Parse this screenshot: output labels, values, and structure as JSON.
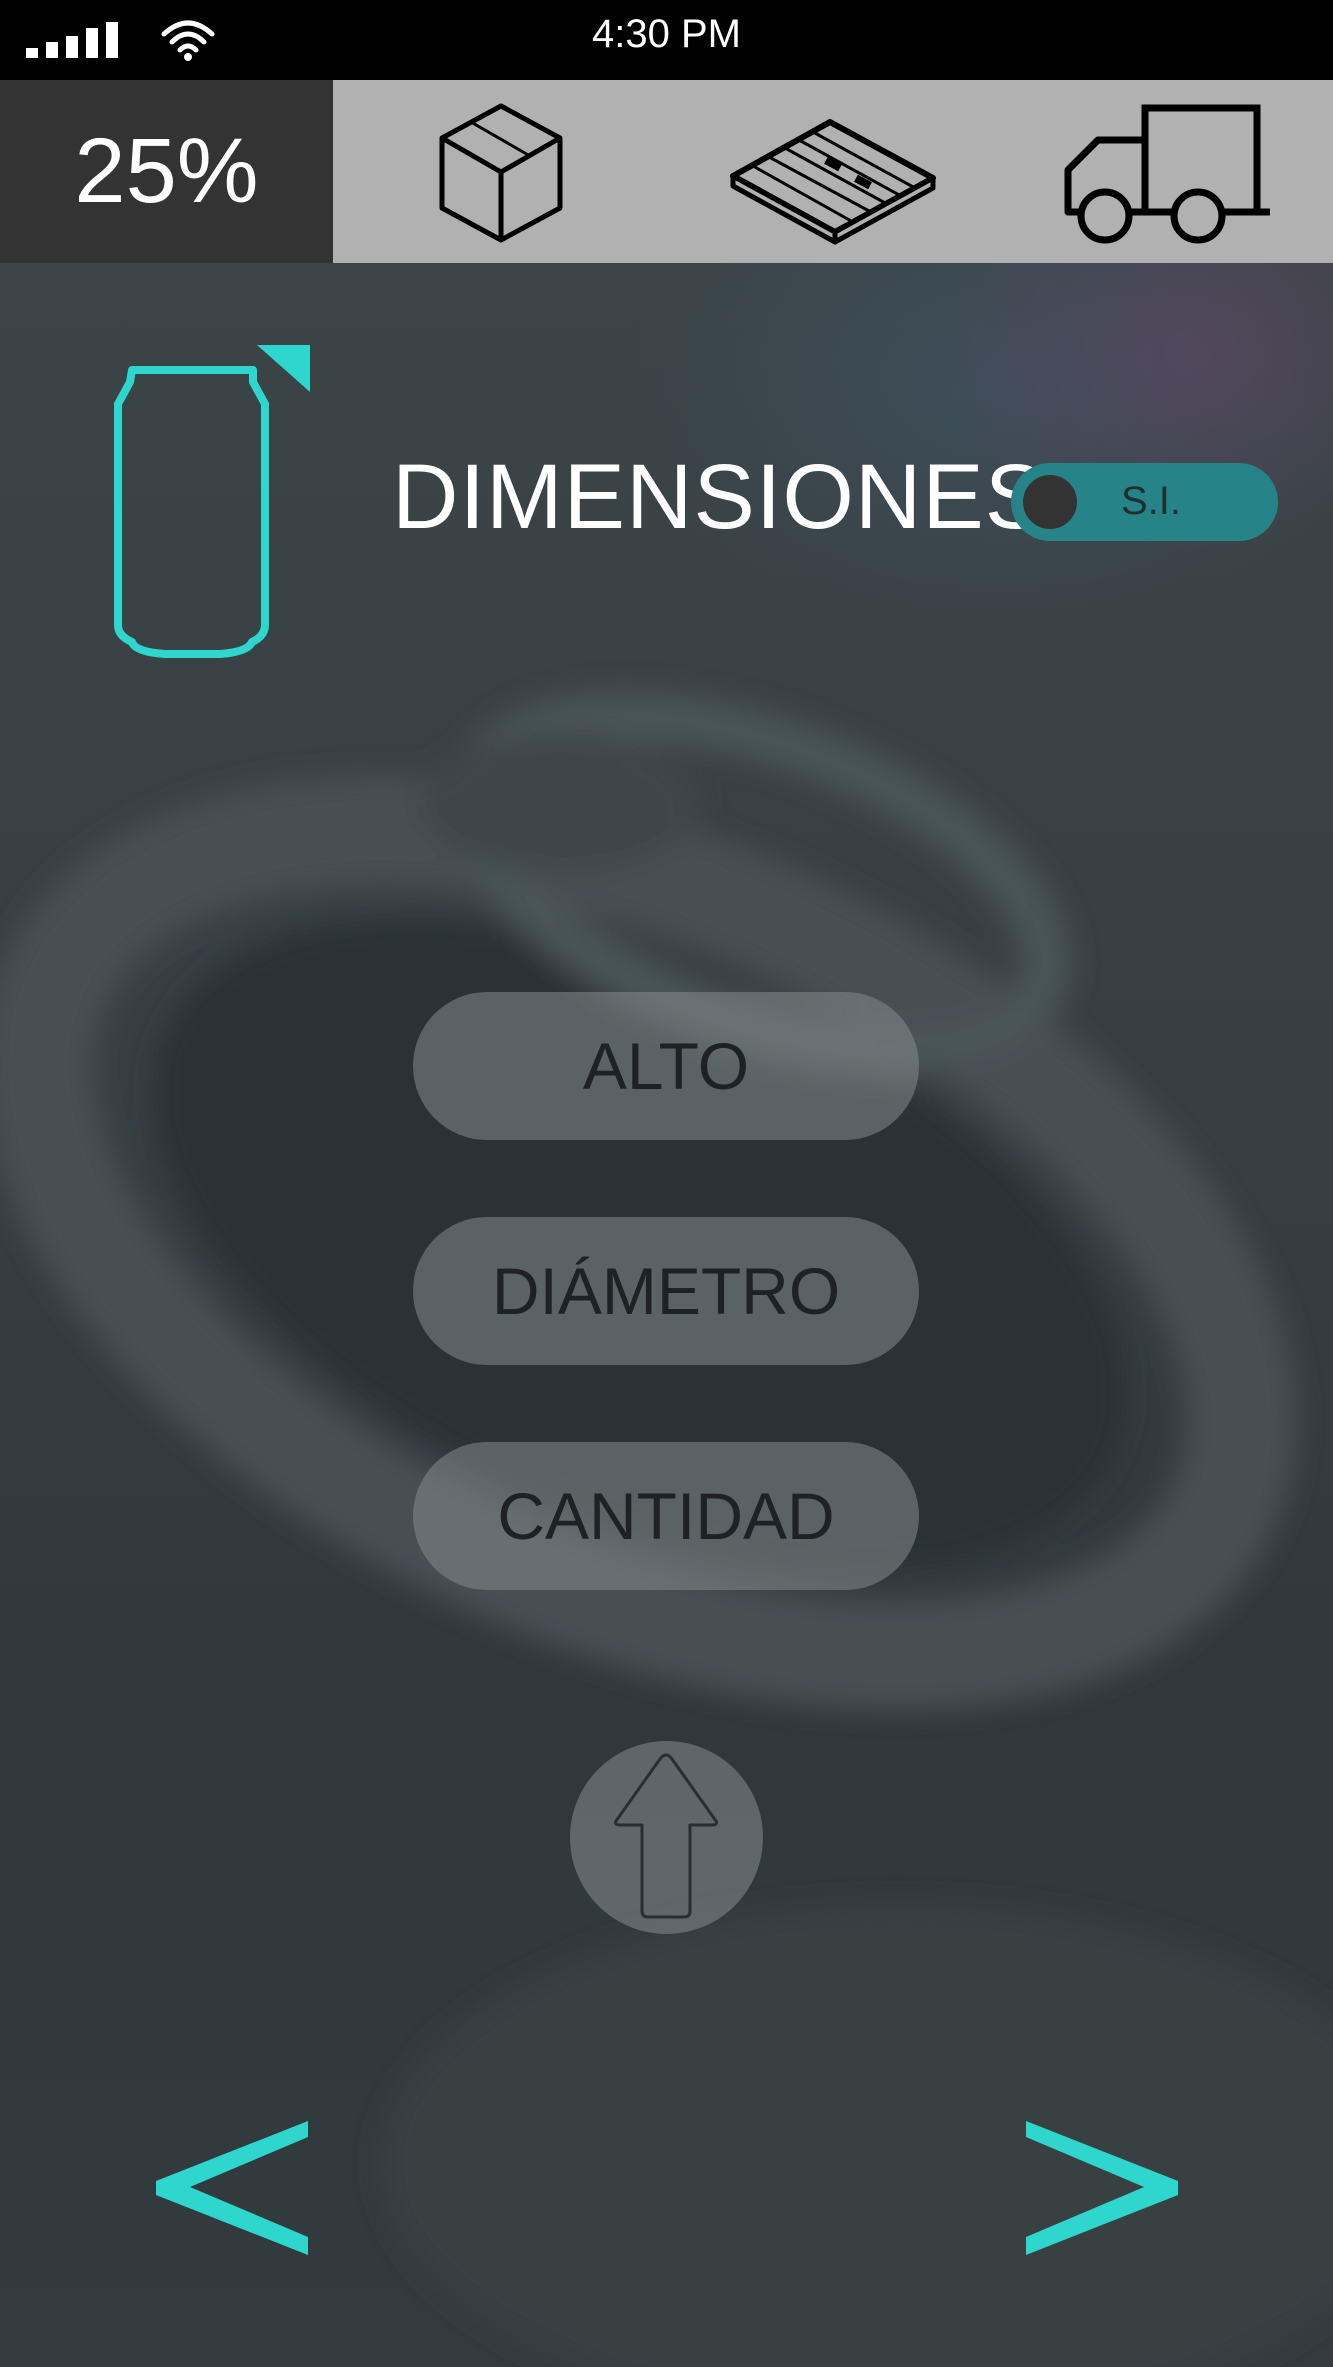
{
  "status_bar": {
    "time": "4:30 PM",
    "signal_icon": "signal-bars-icon",
    "wifi_icon": "wifi-icon"
  },
  "top_nav": {
    "progress": "25%",
    "steps": [
      {
        "icon": "box-icon"
      },
      {
        "icon": "pallet-icon"
      },
      {
        "icon": "truck-icon"
      }
    ]
  },
  "section": {
    "icon": "can-icon",
    "title": "DIMENSIONES",
    "unit_toggle_label": "S.I."
  },
  "buttons": {
    "alto": "ALTO",
    "diametro": "DIÁMETRO",
    "cantidad": "CANTIDAD"
  },
  "navigation": {
    "upload_icon": "arrow-up-icon",
    "prev_icon": "chevron-left-icon",
    "next_icon": "chevron-right-icon"
  },
  "colors": {
    "accent": "#2fd6ce",
    "toggle": "#268488",
    "status_bar": "#000000",
    "nav_background": "#b1b1b1",
    "progress_background": "#333333"
  }
}
